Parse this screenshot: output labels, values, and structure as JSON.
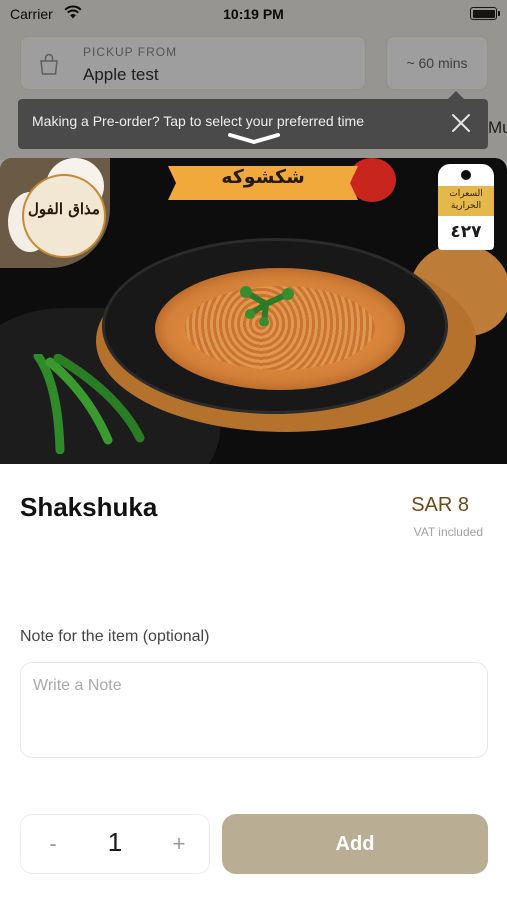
{
  "status_bar": {
    "carrier": "Carrier",
    "time": "10:19 PM"
  },
  "pickup": {
    "label": "PICKUP FROM",
    "value": "Apple test",
    "eta": "~ 60 mins"
  },
  "menu_peek": "Mu",
  "tooltip": {
    "message": "Making a Pre-order? Tap to select your preferred time"
  },
  "photo": {
    "banner_text": "شكشوكه",
    "logo_text": "مذاق الفول",
    "calorie_tag_label": "السعرات الحرارية",
    "calorie_tag_value": "٤٢٧"
  },
  "item": {
    "name": "Shakshuka",
    "price": "SAR 8",
    "vat_note": "VAT included"
  },
  "note": {
    "label": "Note for the item (optional)",
    "placeholder": "Write a Note",
    "value": ""
  },
  "quantity": {
    "minus": "-",
    "value": "1",
    "plus": "+"
  },
  "actions": {
    "add_label": "Add"
  },
  "colors": {
    "accent_price": "#6b4a18",
    "add_button": "#b9ad94",
    "tooltip_bg": "#4a4a4a"
  }
}
